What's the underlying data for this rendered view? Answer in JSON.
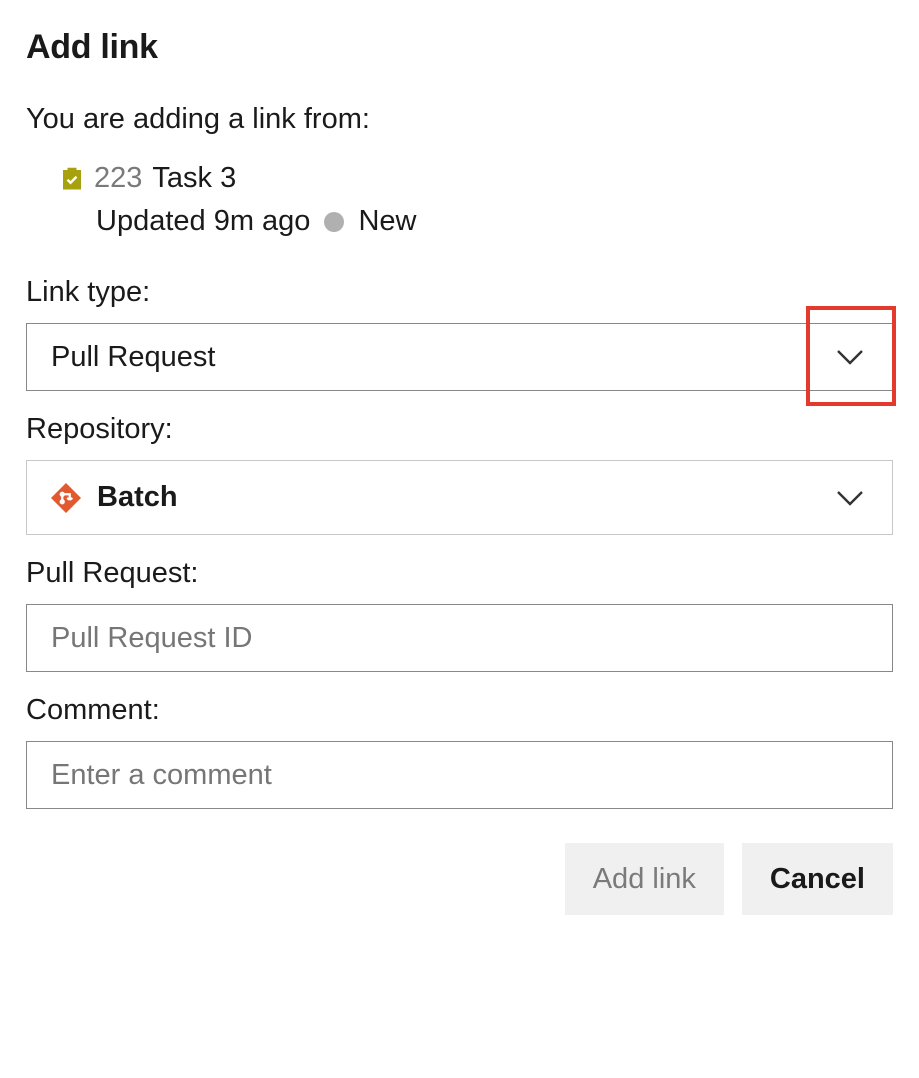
{
  "dialog": {
    "title": "Add link",
    "intro": "You are adding a link from:"
  },
  "workItem": {
    "id": "223",
    "title": "Task 3",
    "updated": "Updated 9m ago",
    "state": "New"
  },
  "fields": {
    "linkType": {
      "label": "Link type:",
      "value": "Pull Request"
    },
    "repository": {
      "label": "Repository:",
      "value": "Batch"
    },
    "pullRequest": {
      "label": "Pull Request:",
      "placeholder": "Pull Request ID"
    },
    "comment": {
      "label": "Comment:",
      "placeholder": "Enter a comment"
    }
  },
  "buttons": {
    "primary": "Add link",
    "secondary": "Cancel"
  }
}
